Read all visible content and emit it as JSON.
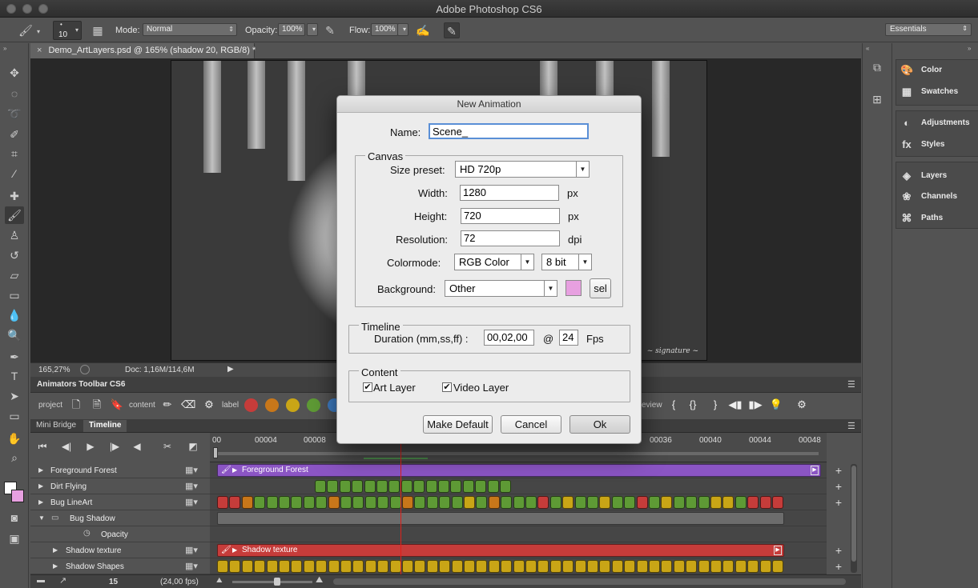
{
  "app": {
    "title": "Adobe Photoshop CS6"
  },
  "options_bar": {
    "brush_size": "10",
    "mode_label": "Mode:",
    "mode_value": "Normal",
    "opacity_label": "Opacity:",
    "opacity_value": "100%",
    "flow_label": "Flow:",
    "flow_value": "100%",
    "workspace": "Essentials"
  },
  "document": {
    "tab_title": "Demo_ArtLayers.psd @ 165% (shadow  20, RGB/8) *",
    "zoom": "165,27%",
    "doc_info": "Doc: 1,16M/114,6M"
  },
  "animators_toolbar": {
    "title": "Animators Toolbar CS6",
    "project_label": "project",
    "content_label": "content",
    "label_label": "label",
    "review_label": "eview",
    "label_colors": [
      "#c63c3a",
      "#c8771a",
      "#c9a516",
      "#5e9a35",
      "#3f7fc8"
    ]
  },
  "timeline": {
    "tabs": [
      "Mini Bridge",
      "Timeline"
    ],
    "ruler_labels": [
      "00",
      "00004",
      "00008",
      "00036",
      "00040",
      "00044",
      "00048"
    ],
    "layers": [
      {
        "name": "Foreground Forest"
      },
      {
        "name": "Dirt Flying"
      },
      {
        "name": "Bug LineArt"
      },
      {
        "name": "Bug Shadow"
      },
      {
        "name": "Opacity"
      },
      {
        "name": "Shadow texture"
      },
      {
        "name": "Shadow Shapes"
      }
    ],
    "bar_labels": {
      "foreground": "Foreground Forest",
      "shadow_texture": "Shadow texture"
    },
    "frame_number": "15",
    "fps": "(24,00 fps)",
    "colors": {
      "purple": "#8b55c4",
      "green": "#5e9a35",
      "red": "#c63c3a",
      "orange": "#c8771a",
      "yellow": "#c9a516",
      "playhead": "#e0201a"
    }
  },
  "right_panels": {
    "items": [
      "Color",
      "Swatches",
      "Adjustments",
      "Styles",
      "Layers",
      "Channels",
      "Paths"
    ],
    "icons": [
      "palette-icon",
      "swatches-icon",
      "adjustments-icon",
      "styles-icon",
      "layers-icon",
      "channels-icon",
      "paths-icon"
    ]
  },
  "dialog": {
    "title": "New Animation",
    "name_label": "Name:",
    "name_value": "Scene_",
    "canvas_legend": "Canvas",
    "size_preset_label": "Size preset:",
    "size_preset_value": "HD 720p",
    "width_label": "Width:",
    "width_value": "1280",
    "height_label": "Height:",
    "height_value": "720",
    "resolution_label": "Resolution:",
    "resolution_value": "72",
    "unit_px": "px",
    "unit_dpi": "dpi",
    "colormode_label": "Colormode:",
    "colormode_value": "RGB Color",
    "bitdepth_value": "8 bit",
    "background_label": "Background:",
    "background_value": "Other",
    "background_color": "#e7a0e0",
    "sel_label": "sel",
    "timeline_legend": "Timeline",
    "duration_label": "Duration (mm,ss,ff) :",
    "duration_value": "00,02,00",
    "at_label": "@",
    "fps_value": "24",
    "fps_label": "Fps",
    "content_legend": "Content",
    "art_layer_label": "Art Layer",
    "video_layer_label": "Video Layer",
    "make_default_label": "Make Default",
    "cancel_label": "Cancel",
    "ok_label": "Ok"
  }
}
